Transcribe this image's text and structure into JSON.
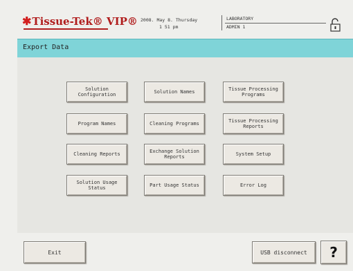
{
  "header": {
    "logo_text": "Tissue-Tek® VIP®",
    "date": "2008. May 8. Thursday",
    "time": "1 51 pm",
    "location": "LABORATORY",
    "user": "ADMIN 1",
    "lock_icon": "padlock-icon"
  },
  "page": {
    "title": "Export Data"
  },
  "buttons": [
    {
      "label": "Solution\nConfiguration"
    },
    {
      "label": "Solution Names"
    },
    {
      "label": "Tissue Processing\nPrograms"
    },
    {
      "label": "Program Names"
    },
    {
      "label": "Cleaning Programs"
    },
    {
      "label": "Tissue Processing\nReports"
    },
    {
      "label": "Cleaning Reports"
    },
    {
      "label": "Exchange Solution\nReports"
    },
    {
      "label": "System Setup"
    },
    {
      "label": "Solution Usage\nStatus"
    },
    {
      "label": "Part Usage Status"
    },
    {
      "label": "Error Log"
    }
  ],
  "footer": {
    "exit_label": "Exit",
    "usb_label": "USB disconnect",
    "help_label": "?"
  },
  "colors": {
    "title_bar": "#7fd4d8",
    "brand_red": "#b01d1d"
  }
}
